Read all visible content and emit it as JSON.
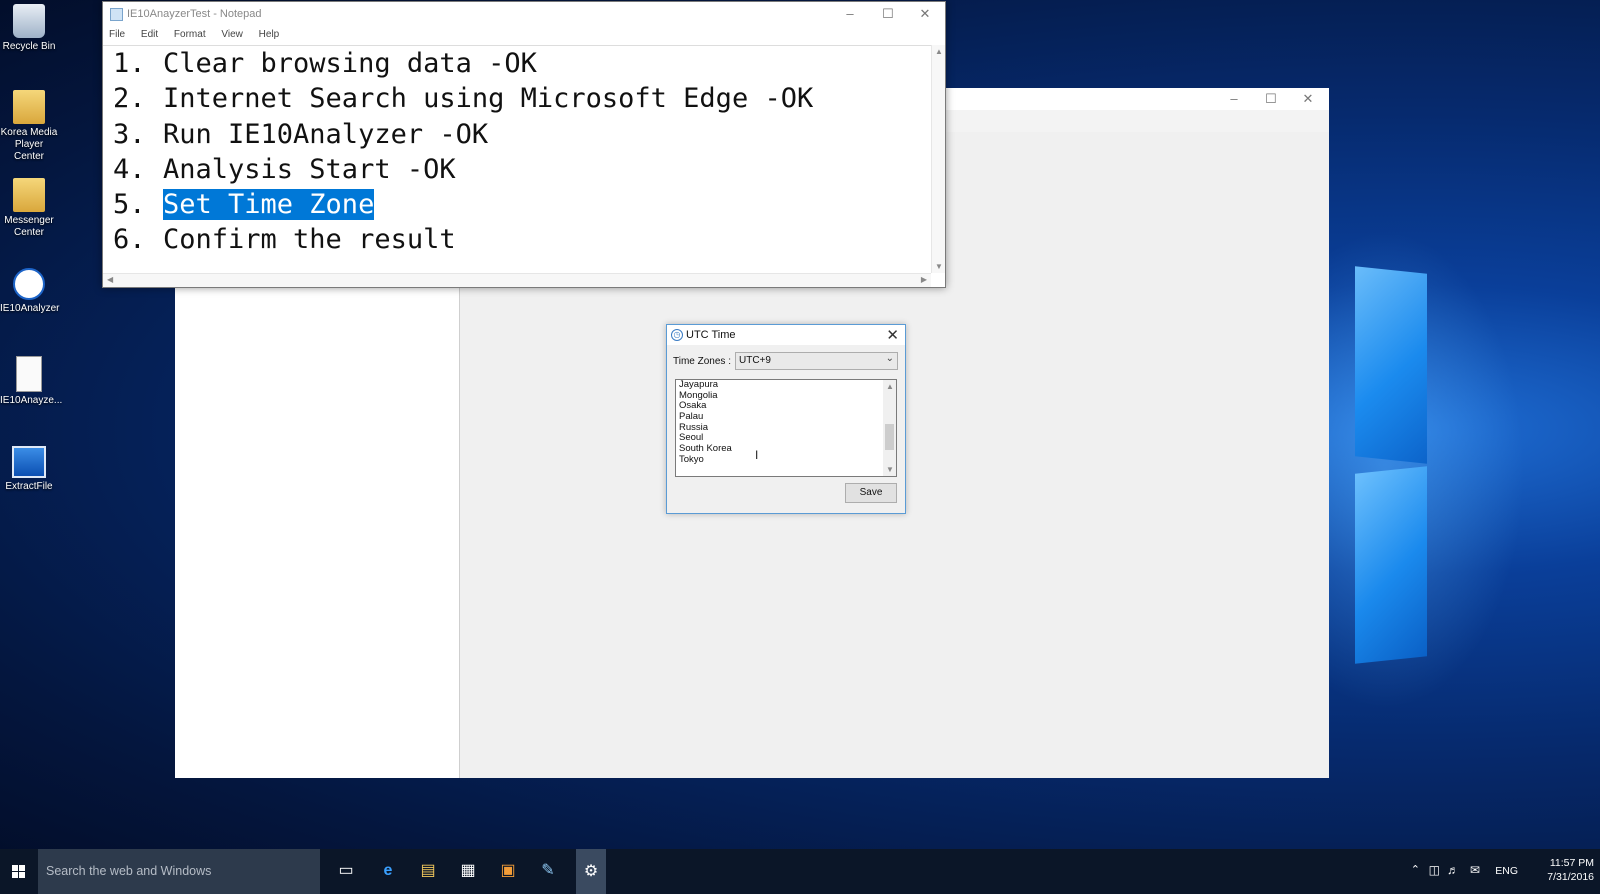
{
  "desktop": {
    "icons": [
      {
        "label": "Recycle Bin",
        "icon": "recycle-bin-icon"
      },
      {
        "label": "Korea Media Player Center",
        "icon": "folder-icon"
      },
      {
        "label": "Messenger Center",
        "icon": "folder-icon"
      },
      {
        "label": "IE10Analyzer",
        "icon": "ie10analyzer-icon"
      },
      {
        "label": "IE10Anayze...",
        "icon": "text-file-icon"
      },
      {
        "label": "ExtractFile",
        "icon": "extractfile-icon"
      }
    ]
  },
  "notepad": {
    "title": "IE10AnayzerTest - Notepad",
    "menu": [
      "File",
      "Edit",
      "Format",
      "View",
      "Help"
    ],
    "lines": [
      {
        "num": "1.",
        "text": "Clear browsing data -OK"
      },
      {
        "num": "2.",
        "text": "Internet Search using Microsoft Edge -OK"
      },
      {
        "num": "3.",
        "text": "Run IE10Analyzer -OK"
      },
      {
        "num": "4.",
        "text": "Analysis Start -OK"
      },
      {
        "num": "5.",
        "text": "Set Time Zone"
      },
      {
        "num": "6.",
        "text": "Confirm the result"
      }
    ],
    "selected_line": 5
  },
  "utc_dialog": {
    "title": "UTC Time",
    "time_zones_label": "Time Zones :",
    "time_zones_value": "UTC+9",
    "list_items": [
      "Jayapura",
      "Mongolia",
      "Osaka",
      "Palau",
      "Russia",
      "Seoul",
      "South Korea",
      "Tokyo"
    ],
    "save_label": "Save"
  },
  "taskbar": {
    "search_placeholder": "Search the web and Windows",
    "language": "ENG",
    "time": "11:57 PM",
    "date": "7/31/2016",
    "accent": "#0078d7"
  }
}
